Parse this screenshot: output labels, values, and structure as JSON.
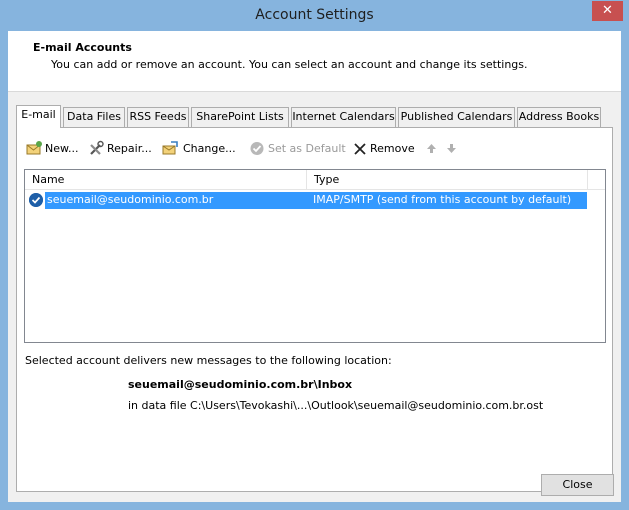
{
  "window": {
    "title": "Account Settings",
    "close_glyph": "✕"
  },
  "header": {
    "title": "E-mail Accounts",
    "description": "You can add or remove an account. You can select an account and change its settings."
  },
  "tabs": [
    {
      "label": "E-mail",
      "active": true
    },
    {
      "label": "Data Files"
    },
    {
      "label": "RSS Feeds"
    },
    {
      "label": "SharePoint Lists"
    },
    {
      "label": "Internet Calendars"
    },
    {
      "label": "Published Calendars"
    },
    {
      "label": "Address Books"
    }
  ],
  "toolbar": {
    "new_label": "New...",
    "repair_label": "Repair...",
    "change_label": "Change...",
    "set_default_label": "Set as Default",
    "remove_label": "Remove",
    "icons": {
      "new": "new-account-icon",
      "repair": "repair-tools-icon",
      "change": "change-account-icon",
      "set_default": "check-circle-icon",
      "remove": "x-remove-icon",
      "up": "arrow-up-icon",
      "down": "arrow-down-icon"
    }
  },
  "accounts_list": {
    "columns": {
      "name": "Name",
      "type": "Type"
    },
    "rows": [
      {
        "name": "seuemail@seudominio.com.br",
        "type": "IMAP/SMTP (send from this account by default)",
        "selected": true
      }
    ]
  },
  "delivery": {
    "intro": "Selected account delivers new messages to the following location:",
    "inbox": "seuemail@seudominio.com.br\\Inbox",
    "data_file": "in data file C:\\Users\\Tevokashi\\...\\Outlook\\seuemail@seudominio.com.br.ost"
  },
  "footer": {
    "close_label": "Close"
  },
  "colors": {
    "frame": "#86b4de",
    "selection": "#3399ff",
    "close_red": "#c75050"
  }
}
